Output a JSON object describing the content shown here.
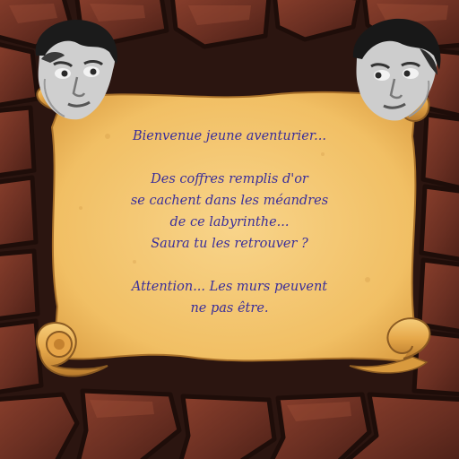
{
  "scroll": {
    "greeting": "Bienvenue jeune aventurier...",
    "story": [
      "Des coffres remplis d'or",
      "se cachent dans les méandres",
      "de ce labyrinthe...",
      "Saura tu les retrouver ?"
    ],
    "warning": [
      "Attention... Les murs peuvent",
      "ne pas être."
    ]
  },
  "colors": {
    "text": "#3b2f9a",
    "parchment": "#f1bf64",
    "stone": "#6a2f22"
  },
  "icons": {
    "portrait_left": "face-portrait-icon",
    "portrait_right": "face-portrait-icon"
  }
}
